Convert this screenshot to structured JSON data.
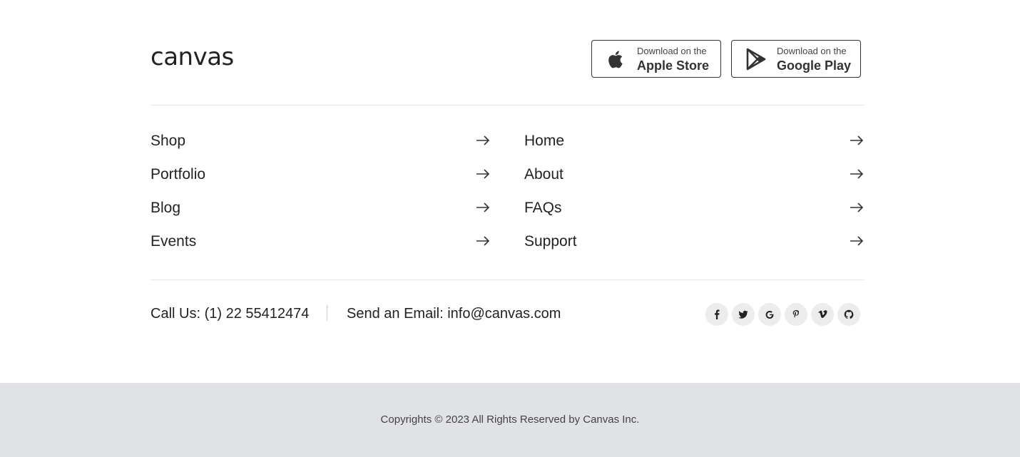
{
  "brand": {
    "logo_text": "canvas"
  },
  "app_buttons": {
    "apple": {
      "small": "Download on the",
      "big": "Apple Store",
      "icon": "apple-icon"
    },
    "google": {
      "small": "Download on the",
      "big": "Google Play",
      "icon": "google-play-icon"
    }
  },
  "nav": {
    "left": [
      {
        "label": "Shop"
      },
      {
        "label": "Portfolio"
      },
      {
        "label": "Blog"
      },
      {
        "label": "Events"
      }
    ],
    "right": [
      {
        "label": "Home"
      },
      {
        "label": "About"
      },
      {
        "label": "FAQs"
      },
      {
        "label": "Support"
      }
    ],
    "arrow_icon": "arrow-right-icon"
  },
  "contact": {
    "call": "Call Us: (1) 22 55412474",
    "email": "Send an Email: info@canvas.com"
  },
  "social": [
    {
      "name": "facebook-icon"
    },
    {
      "name": "twitter-icon"
    },
    {
      "name": "google-icon"
    },
    {
      "name": "pinterest-icon"
    },
    {
      "name": "vimeo-icon"
    },
    {
      "name": "github-icon"
    }
  ],
  "footer": {
    "copyright": "Copyrights © 2023 All Rights Reserved by Canvas Inc."
  },
  "colors": {
    "text": "#222222",
    "divider": "#e5e5e5",
    "footer_bg": "#e0e2e5",
    "social_bg": "#ececec"
  }
}
